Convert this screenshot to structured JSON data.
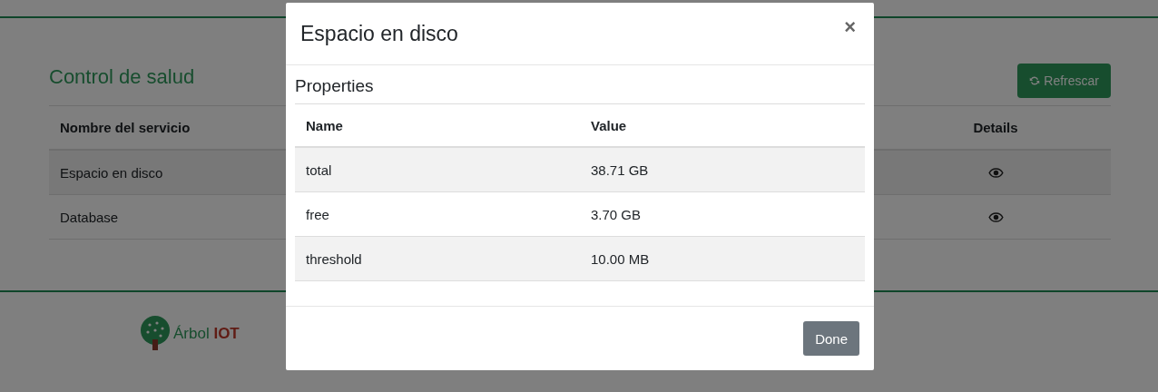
{
  "page": {
    "title": "Control de salud",
    "refresh_button": "Refrescar",
    "table": {
      "columns": [
        "Nombre del servicio",
        "Details"
      ],
      "rows": [
        {
          "name": "Espacio en disco"
        },
        {
          "name": "Database"
        }
      ]
    }
  },
  "footer": {
    "logo_word": "Árbol",
    "logo_accent": "IOT"
  },
  "modal": {
    "title": "Espacio en disco",
    "close": "×",
    "section": "Properties",
    "columns": [
      "Name",
      "Value"
    ],
    "rows": [
      {
        "name": "total",
        "value": "38.71 GB"
      },
      {
        "name": "free",
        "value": "3.70 GB"
      },
      {
        "name": "threshold",
        "value": "10.00 MB"
      }
    ],
    "done_button": "Done"
  }
}
